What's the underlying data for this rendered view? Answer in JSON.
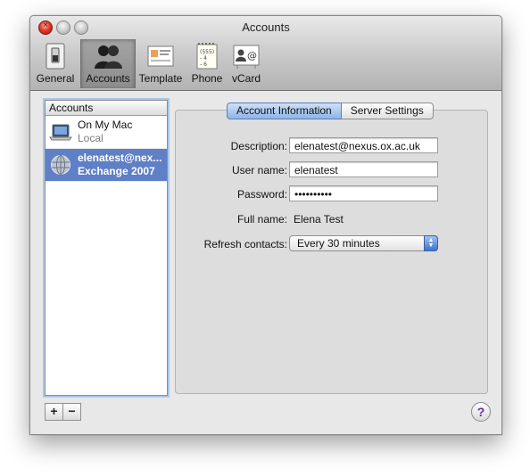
{
  "window": {
    "title": "Accounts"
  },
  "toolbar": {
    "items": [
      {
        "label": "General",
        "icon": "switch-icon"
      },
      {
        "label": "Accounts",
        "icon": "people-icon"
      },
      {
        "label": "Template",
        "icon": "card-template-icon"
      },
      {
        "label": "Phone",
        "icon": "notepad-phone-icon"
      },
      {
        "label": "vCard",
        "icon": "vcard-icon"
      }
    ],
    "selected": "Accounts"
  },
  "sidebar": {
    "header": "Accounts",
    "accounts": [
      {
        "name": "On My Mac",
        "type": "Local",
        "icon": "laptop-icon"
      },
      {
        "name": "elenatest@nex...",
        "type": "Exchange 2007",
        "icon": "globe-icon",
        "selected": true
      }
    ],
    "add_label": "+",
    "remove_label": "−"
  },
  "tabs": {
    "account_info": "Account Information",
    "server_settings": "Server Settings",
    "active": "Account Information"
  },
  "form": {
    "description_label": "Description:",
    "description_value": "elenatest@nexus.ox.ac.uk",
    "username_label": "User name:",
    "username_value": "elenatest",
    "password_label": "Password:",
    "password_value": "••••••••••",
    "fullname_label": "Full name:",
    "fullname_value": "Elena Test",
    "refresh_label": "Refresh contacts:",
    "refresh_value": "Every 30 minutes"
  },
  "help": {
    "label": "?"
  },
  "colors": {
    "selection": "#5f7fc6",
    "close_button": "#e5392b",
    "segment_active": "#8fb4e8"
  }
}
